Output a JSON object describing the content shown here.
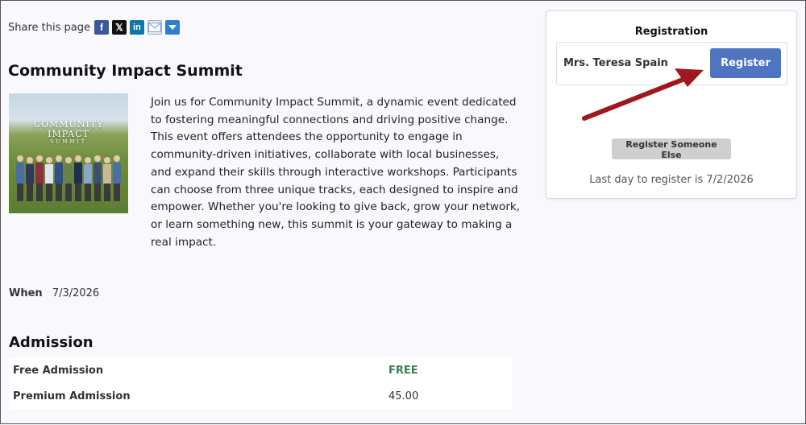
{
  "share": {
    "label": "Share this page",
    "icons": [
      "facebook-icon",
      "x-icon",
      "linkedin-icon",
      "email-icon",
      "more-icon"
    ]
  },
  "event": {
    "title": "Community Impact Summit",
    "image_text": [
      "COMMUNITY",
      "IMPACT",
      "SUMMIT"
    ],
    "description": "Join us for Community Impact Summit, a dynamic event dedicated to fostering meaningful connections and driving positive change. This event offers attendees the opportunity to engage in community-driven initiatives, collaborate with local businesses, and expand their skills through interactive workshops. Participants can choose from three unique tracks, each designed to inspire and empower. Whether you're looking to give back, grow your network, or learn something new, this summit is your gateway to making a real impact.",
    "when_label": "When",
    "when_value": "7/3/2026"
  },
  "admission": {
    "heading": "Admission",
    "rows": [
      {
        "name": "Free Admission",
        "price": "FREE"
      },
      {
        "name": "Premium Admission",
        "price": "45.00"
      }
    ]
  },
  "registration": {
    "title": "Registration",
    "user_name": "Mrs. Teresa Spain",
    "register_label": "Register",
    "register_else_label": "Register Someone Else",
    "last_day_text": "Last day to register is 7/2/2026"
  },
  "colors": {
    "accent": "#4f74c0",
    "free": "#3e7a5a",
    "arrow": "#a0171d"
  }
}
